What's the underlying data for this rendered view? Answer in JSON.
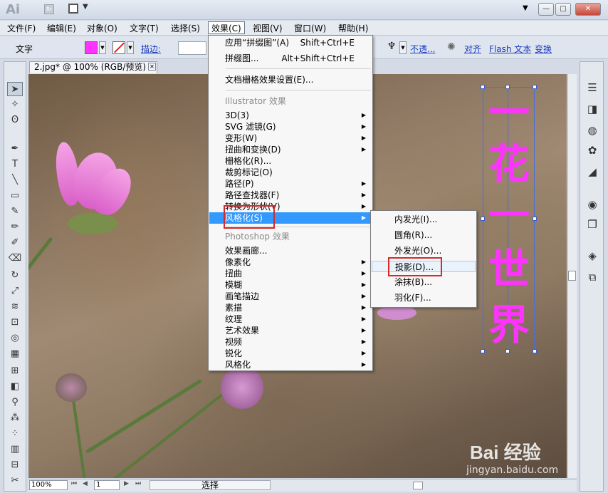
{
  "titlebar": {
    "app_logo": "Ai",
    "bridge_label": "Br",
    "window_controls": [
      "▼",
      "—",
      "□",
      "✕"
    ]
  },
  "menubar": {
    "items": [
      "文件(F)",
      "编辑(E)",
      "对象(O)",
      "文字(T)",
      "选择(S)",
      "效果(C)",
      "视图(V)",
      "窗口(W)",
      "帮助(H)"
    ],
    "active": "效果(C)"
  },
  "controlbar": {
    "label": "文字",
    "fill_color": "#ff33ff",
    "stroke_label": "描边:",
    "opacity_label": "不透...",
    "align_label": "对齐",
    "flash_label": "Flash 文本",
    "transform_label": "变换"
  },
  "document": {
    "tab_title": "2.jpg* @ 100% (RGB/预览)",
    "close": "✕"
  },
  "artwork": {
    "glyphs": [
      "一",
      "花",
      "一",
      "世",
      "界"
    ],
    "text_color": "#ff33ff"
  },
  "statusbar": {
    "zoom": "100%",
    "page": "1",
    "mode": "选择"
  },
  "effect_menu": {
    "top_items": [
      {
        "label": "应用“拼缀图”(A)",
        "shortcut": "Shift+Ctrl+E"
      },
      {
        "label": "拼缀图...",
        "shortcut": "Alt+Shift+Ctrl+E"
      }
    ],
    "doc_raster_settings": "文档栅格效果设置(E)...",
    "illustrator_header": "Illustrator 效果",
    "illustrator_items": [
      "3D(3)",
      "SVG 滤镜(G)",
      "变形(W)",
      "扭曲和变换(D)",
      "栅格化(R)...",
      "裁剪标记(O)",
      "路径(P)",
      "路径查找器(F)",
      "转换为形状(V)",
      "风格化(S)"
    ],
    "photoshop_header": "Photoshop 效果",
    "photoshop_items": [
      "效果画廊...",
      "像素化",
      "扭曲",
      "模糊",
      "画笔描边",
      "素描",
      "纹理",
      "艺术效果",
      "视频",
      "锐化",
      "风格化"
    ]
  },
  "stylize_submenu": {
    "items": [
      "内发光(I)...",
      "圆角(R)...",
      "外发光(O)...",
      "投影(D)...",
      "涂抹(B)...",
      "羽化(F)..."
    ],
    "selected": "投影(D)..."
  },
  "watermark": {
    "brand": "Bai  经验",
    "url": "jingyan.baidu.com"
  }
}
